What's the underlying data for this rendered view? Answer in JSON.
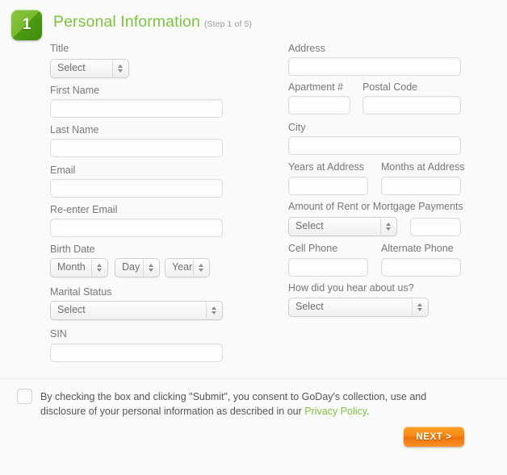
{
  "header": {
    "step_number": "1",
    "title": "Personal Information",
    "step_text": "(Step 1 of 5)"
  },
  "left_column": {
    "title": {
      "label": "Title",
      "value": "Select"
    },
    "first_name": {
      "label": "First Name",
      "value": ""
    },
    "last_name": {
      "label": "Last Name",
      "value": ""
    },
    "email": {
      "label": "Email",
      "value": ""
    },
    "reenter_email": {
      "label": "Re-enter Email",
      "value": ""
    },
    "birth_date": {
      "label": "Birth Date",
      "month": "Month",
      "day": "Day",
      "year": "Year"
    },
    "marital_status": {
      "label": "Marital Status",
      "value": "Select"
    },
    "sin": {
      "label": "SIN",
      "value": ""
    }
  },
  "right_column": {
    "address": {
      "label": "Address",
      "value": ""
    },
    "apartment": {
      "label": "Apartment #",
      "value": ""
    },
    "postal_code": {
      "label": "Postal Code",
      "value": ""
    },
    "city": {
      "label": "City",
      "value": ""
    },
    "years_at_address": {
      "label": "Years at Address",
      "value": ""
    },
    "months_at_address": {
      "label": "Months at Address",
      "value": ""
    },
    "rent_amount": {
      "label": "Amount of Rent or Mortgage Payments",
      "frequency": "Select",
      "amount": ""
    },
    "cell_phone": {
      "label": "Cell Phone",
      "value": ""
    },
    "alternate_phone": {
      "label": "Alternate Phone",
      "value": ""
    },
    "referral": {
      "label": "How did you hear about us?",
      "value": "Select"
    }
  },
  "consent": {
    "text_before_link": "By checking the box and clicking \"Submit\", you consent to GoDay's collection, use and disclosure of your personal information as described in our ",
    "link_text": "Privacy Policy",
    "text_after_link": "."
  },
  "next_button": {
    "label": "NEXT >"
  },
  "colors": {
    "brand_green": "#7dc242",
    "badge_green": "#76bb2e",
    "button_orange": "#f58a16",
    "label_gray": "#777777",
    "background": "#fafafa"
  }
}
